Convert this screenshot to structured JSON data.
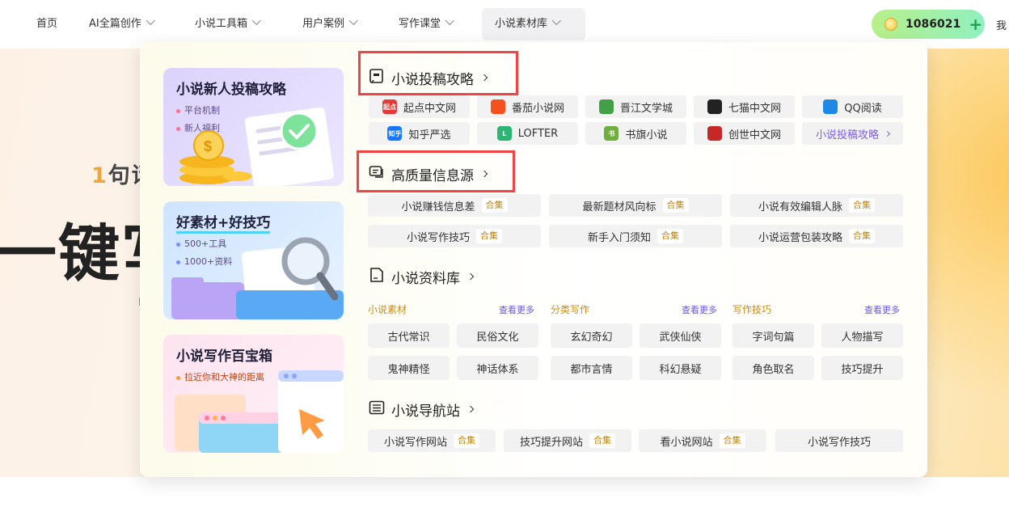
{
  "nav": {
    "items": [
      {
        "label": "首页",
        "has_arrow": false
      },
      {
        "label": "AI全篇创作",
        "has_arrow": true
      },
      {
        "label": "小说工具箱",
        "has_arrow": true
      },
      {
        "label": "用户案例",
        "has_arrow": true
      },
      {
        "label": "写作课堂",
        "has_arrow": true
      },
      {
        "label": "小说素材库",
        "has_arrow": true,
        "active": true
      }
    ],
    "coins": "1086021",
    "coin_plus": "+",
    "tail_text": "我"
  },
  "hero": {
    "sub_num": "1",
    "sub_text": "句话",
    "big_text": "一键写"
  },
  "cards": [
    {
      "title": "小说新人投稿攻略",
      "bullets": [
        "平台机制",
        "新人福利"
      ]
    },
    {
      "title": "好素材+好技巧",
      "bullets": [
        "500+工具",
        "1000+资料"
      ]
    },
    {
      "title": "小说写作百宝箱",
      "bullets": [
        "拉近你和大神的距离"
      ]
    }
  ],
  "sections": {
    "submit": {
      "title": "小说投稿攻略",
      "sites": [
        {
          "label": "起点中文网",
          "logo_text": "起点",
          "color": "#e53935"
        },
        {
          "label": "番茄小说网",
          "logo_text": "",
          "color": "#f4511e"
        },
        {
          "label": "晋江文学城",
          "logo_text": "",
          "color": "#43a047"
        },
        {
          "label": "七猫中文网",
          "logo_text": "",
          "color": "#222222"
        },
        {
          "label": "QQ阅读",
          "logo_text": "",
          "color": "#1e88e5"
        },
        {
          "label": "知乎严选",
          "logo_text": "知乎",
          "color": "#1677ff"
        },
        {
          "label": "LOFTER",
          "logo_text": "L",
          "color": "#2bb673"
        },
        {
          "label": "书旗小说",
          "logo_text": "书",
          "color": "#6fae3f"
        },
        {
          "label": "创世中文网",
          "logo_text": "",
          "color": "#c62828"
        }
      ],
      "more_label": "小说投稿攻略"
    },
    "info": {
      "title": "高质量信息源",
      "badge": "合集",
      "items": [
        "小说赚钱信息差",
        "最新题材风向标",
        "小说有效编辑人脉",
        "小说写作技巧",
        "新手入门须知",
        "小说运营包装攻略"
      ]
    },
    "library": {
      "title": "小说资料库",
      "more": "查看更多",
      "categories": [
        {
          "label": "小说素材",
          "items": [
            "古代常识",
            "民俗文化",
            "鬼神精怪",
            "神话体系"
          ]
        },
        {
          "label": "分类写作",
          "items": [
            "玄幻奇幻",
            "武侠仙侠",
            "都市言情",
            "科幻悬疑"
          ]
        },
        {
          "label": "写作技巧",
          "items": [
            "字词句篇",
            "人物描写",
            "角色取名",
            "技巧提升"
          ]
        }
      ]
    },
    "nav_site": {
      "title": "小说导航站",
      "badge": "合集",
      "items": [
        "小说写作网站",
        "技巧提升网站",
        "看小说网站",
        "小说写作技巧"
      ]
    }
  },
  "colors": {
    "highlight_box": "#ef4444",
    "badge_text": "#c2850c",
    "link": "#7c5cf0"
  }
}
